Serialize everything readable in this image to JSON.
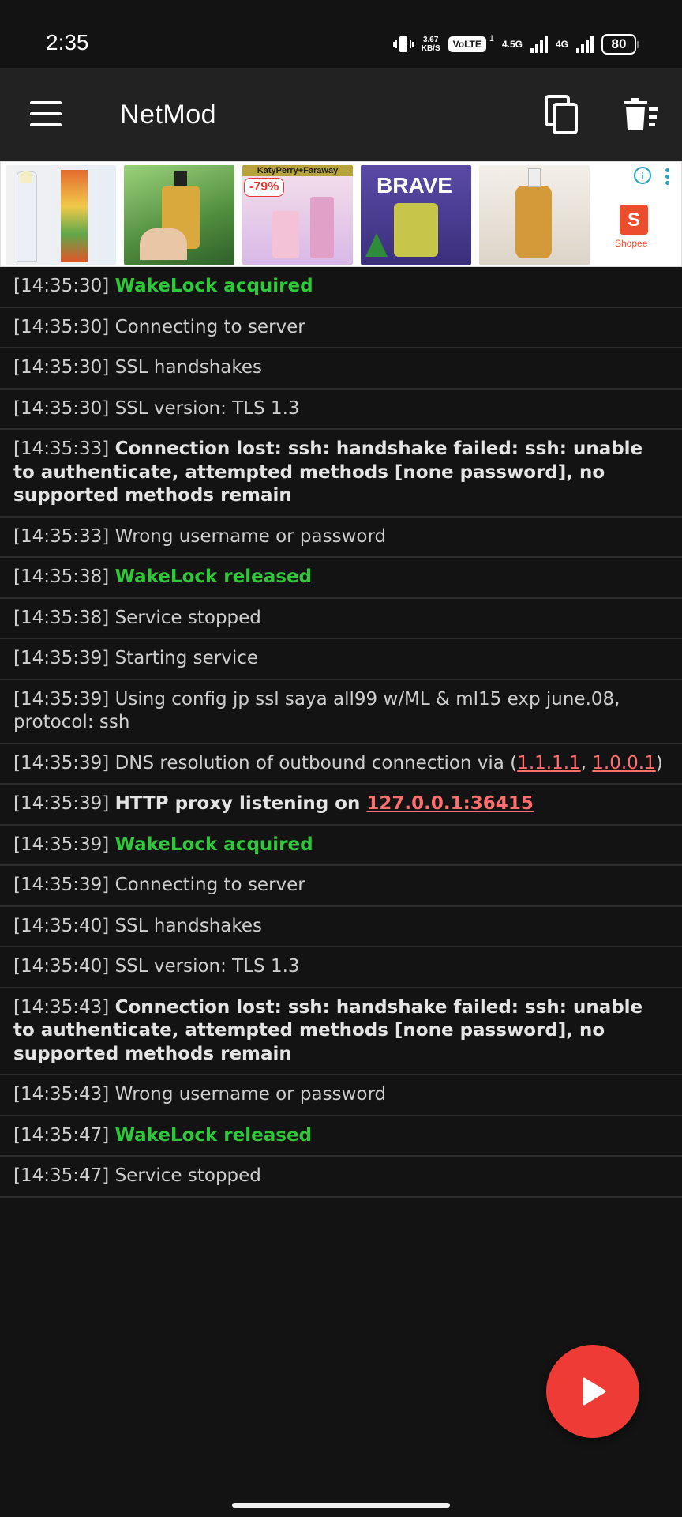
{
  "status_bar": {
    "time": "2:35",
    "speed_top": "3.67",
    "speed_bottom": "KB/S",
    "volte": "VoLTE",
    "volte_sup": "1",
    "net1": "4.5G",
    "net2": "4G",
    "battery": "80"
  },
  "toolbar": {
    "title": "NetMod",
    "menu_icon": "hamburger-menu-icon",
    "copy_icon": "copy-icon",
    "delete_icon": "delete-log-icon"
  },
  "ad": {
    "tag_bar": "KatyPerry+Faraway",
    "discount": "-79%",
    "brave": "BRAVE",
    "shopee_letter": "S",
    "shopee": "Shopee"
  },
  "log": [
    {
      "time": "[14:35:30]",
      "parts": [
        {
          "text": "WakeLock acquired",
          "style": "green"
        }
      ]
    },
    {
      "time": "[14:35:30]",
      "parts": [
        {
          "text": "Connecting to server",
          "style": "plain"
        }
      ]
    },
    {
      "time": "[14:35:30]",
      "parts": [
        {
          "text": "SSL handshakes",
          "style": "plain"
        }
      ]
    },
    {
      "time": "[14:35:30]",
      "parts": [
        {
          "text": "SSL version: TLS 1.3",
          "style": "plain"
        }
      ]
    },
    {
      "time": "[14:35:33]",
      "parts": [
        {
          "text": "Connection lost: ssh: handshake failed: ssh: unable to authenticate, attempted methods [none password], no supported methods remain",
          "style": "bold"
        }
      ]
    },
    {
      "time": "[14:35:33]",
      "parts": [
        {
          "text": "Wrong username or password",
          "style": "plain"
        }
      ]
    },
    {
      "time": "[14:35:38]",
      "parts": [
        {
          "text": "WakeLock released",
          "style": "green"
        }
      ]
    },
    {
      "time": "[14:35:38]",
      "parts": [
        {
          "text": "Service stopped",
          "style": "plain"
        }
      ]
    },
    {
      "time": "[14:35:39]",
      "parts": [
        {
          "text": "Starting service",
          "style": "plain"
        }
      ]
    },
    {
      "time": "[14:35:39]",
      "parts": [
        {
          "text": "Using config jp ssl saya all99 w/ML & ml15 exp june.08, protocol: ssh",
          "style": "plain"
        }
      ]
    },
    {
      "time": "[14:35:39]",
      "parts": [
        {
          "text": "DNS resolution of outbound connection via (",
          "style": "plain"
        },
        {
          "text": "1.1.1.1",
          "style": "link"
        },
        {
          "text": ", ",
          "style": "plain"
        },
        {
          "text": "1.0.0.1",
          "style": "link"
        },
        {
          "text": ")",
          "style": "plain"
        }
      ]
    },
    {
      "time": "[14:35:39]",
      "parts": [
        {
          "text": "HTTP proxy listening on ",
          "style": "bold"
        },
        {
          "text": "127.0.0.1:36415",
          "style": "link-b"
        }
      ]
    },
    {
      "time": "[14:35:39]",
      "parts": [
        {
          "text": "WakeLock acquired",
          "style": "green"
        }
      ]
    },
    {
      "time": "[14:35:39]",
      "parts": [
        {
          "text": "Connecting to server",
          "style": "plain"
        }
      ]
    },
    {
      "time": "[14:35:40]",
      "parts": [
        {
          "text": "SSL handshakes",
          "style": "plain"
        }
      ]
    },
    {
      "time": "[14:35:40]",
      "parts": [
        {
          "text": "SSL version: TLS 1.3",
          "style": "plain"
        }
      ]
    },
    {
      "time": "[14:35:43]",
      "parts": [
        {
          "text": "Connection lost: ssh: handshake failed: ssh: unable to authenticate, attempted methods [none password], no supported methods remain",
          "style": "bold"
        }
      ]
    },
    {
      "time": "[14:35:43]",
      "parts": [
        {
          "text": "Wrong username or password",
          "style": "plain"
        }
      ]
    },
    {
      "time": "[14:35:47]",
      "parts": [
        {
          "text": "WakeLock released",
          "style": "green"
        }
      ]
    },
    {
      "time": "[14:35:47]",
      "parts": [
        {
          "text": "Service stopped",
          "style": "plain"
        }
      ]
    }
  ],
  "fab": {
    "icon": "play-icon",
    "color": "#ef3b36"
  },
  "colors": {
    "background": "#131313",
    "toolbar": "#222222",
    "green": "#2fc83a",
    "link": "#ff6e6e"
  }
}
